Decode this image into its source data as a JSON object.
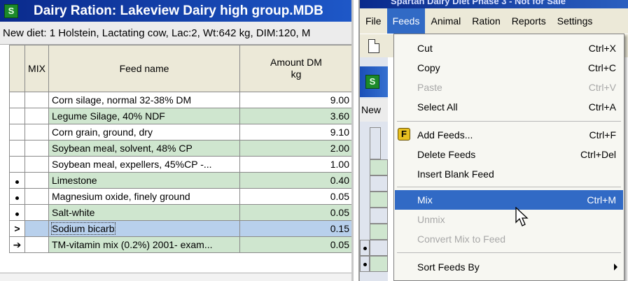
{
  "left_window": {
    "title": "Dairy Ration:  Lakeview Dairy high group.MDB",
    "diet_line": "New diet: 1 Holstein, Lactating cow, Lac:2, Wt:642 kg, DIM:120, M",
    "columns": {
      "mix": "MIX",
      "feed_name": "Feed name",
      "amount_line1": "Amount DM",
      "amount_line2": "kg"
    },
    "rows": [
      {
        "name": "Corn silage, normal 32-38% DM",
        "amount": "9.00"
      },
      {
        "name": "Legume Silage, 40% NDF",
        "amount": "3.60"
      },
      {
        "name": "Corn grain, ground, dry",
        "amount": "9.10"
      },
      {
        "name": "Soybean meal, solvent, 48% CP",
        "amount": "2.00"
      },
      {
        "name": "Soybean meal, expellers, 45%CP -...",
        "amount": "1.00"
      },
      {
        "name": "Limestone",
        "amount": "0.40"
      },
      {
        "name": "Magnesium oxide, finely ground",
        "amount": "0.05"
      },
      {
        "name": "Salt-white",
        "amount": "0.05"
      },
      {
        "name": "Sodium bicarb",
        "amount": "0.15"
      },
      {
        "name": "TM-vitamin mix (0.2%) 2001- exam...",
        "amount": "0.05"
      }
    ]
  },
  "right_window": {
    "title": "Spartan Dairy Diet Phase 3 - Not for Sale",
    "menubar": [
      "File",
      "Feeds",
      "Animal",
      "Ration",
      "Reports",
      "Settings"
    ],
    "bg_new_text": "New",
    "feeds_menu": [
      {
        "label": "Cut",
        "shortcut": "Ctrl+X"
      },
      {
        "label": "Copy",
        "shortcut": "Ctrl+C"
      },
      {
        "label": "Paste",
        "shortcut": "Ctrl+V"
      },
      {
        "label": "Select All",
        "shortcut": "Ctrl+A"
      },
      {
        "label": "Add Feeds...",
        "shortcut": "Ctrl+F"
      },
      {
        "label": "Delete Feeds",
        "shortcut": "Ctrl+Del"
      },
      {
        "label": "Insert Blank Feed",
        "shortcut": ""
      },
      {
        "label": "Mix",
        "shortcut": "Ctrl+M"
      },
      {
        "label": "Unmix",
        "shortcut": ""
      },
      {
        "label": "Convert Mix to Feed",
        "shortcut": ""
      },
      {
        "label": "Sort Feeds By",
        "shortcut": ""
      }
    ]
  },
  "icons": {
    "app": "app-logo-icon",
    "feed": "add-feeds-icon",
    "doc": "new-document-icon",
    "cursor": "mouse-pointer-icon"
  },
  "colors": {
    "title_bar": "#0a2a8c",
    "row_green": "#cfe6cf",
    "selection": "#316ac5",
    "row_highlight": "#b8d0ec"
  }
}
